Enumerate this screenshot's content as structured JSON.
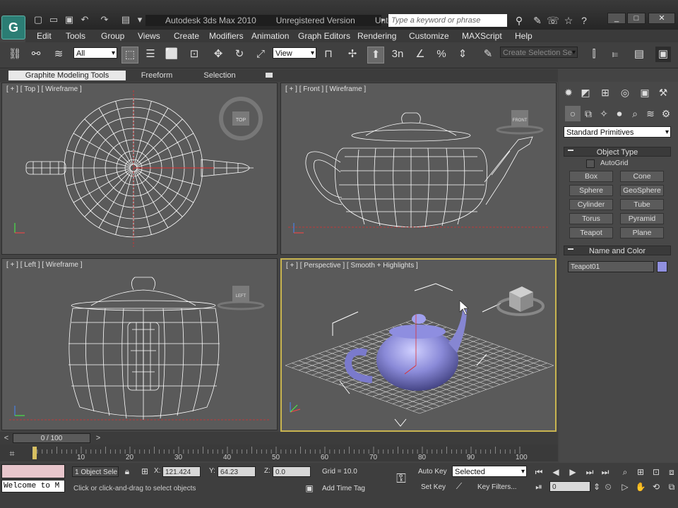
{
  "title_bar": {
    "app_title": "Autodesk 3ds Max  2010",
    "version": "Unregistered Version",
    "filename": "Untitled",
    "search_placeholder": "Type a keyword or phrase",
    "logo_text": "G"
  },
  "menu": [
    "Edit",
    "Tools",
    "Group",
    "Views",
    "Create",
    "Modifiers",
    "Animation",
    "Graph Editors",
    "Rendering",
    "Customize",
    "MAXScript",
    "Help"
  ],
  "toolbar": {
    "filter_value": "All",
    "refcoord_value": "View",
    "selection_set_placeholder": "Create Selection Se",
    "snap_3": "3",
    "snap_n": "n"
  },
  "ribbon": {
    "tabs": [
      "Graphite Modeling Tools",
      "Freeform",
      "Selection"
    ]
  },
  "viewports": {
    "top": {
      "label": "[ + ] [ Top ] [ Wireframe ]",
      "cube": "TOP"
    },
    "front": {
      "label": "[ + ] [ Front ] [ Wireframe ]",
      "cube": "FRONT"
    },
    "left": {
      "label": "[ + ] [ Left ] [ Wireframe ]",
      "cube": "LEFT"
    },
    "perspective": {
      "label": "[ + ] [ Perspective ] [ Smooth + Highlights ]"
    }
  },
  "command_panel": {
    "category_dropdown": "Standard Primitives",
    "object_type_header": "Object Type",
    "autogrid_label": "AutoGrid",
    "buttons": [
      "Box",
      "Cone",
      "Sphere",
      "GeoSphere",
      "Cylinder",
      "Tube",
      "Torus",
      "Pyramid",
      "Teapot",
      "Plane"
    ],
    "name_color_header": "Name and Color",
    "object_name": "Teapot01",
    "object_color": "#9090e0"
  },
  "timeline": {
    "frame_display": "0 / 100",
    "ticks": [
      "10",
      "20",
      "30",
      "40",
      "50",
      "60",
      "70",
      "80",
      "90",
      "100"
    ]
  },
  "status": {
    "listener_text": "Welcome to M",
    "selection_info": "1 Object Sele",
    "prompt": "Click or click-and-drag to select objects",
    "x_label": "X:",
    "x_value": "121.424",
    "y_label": "Y:",
    "y_value": "64.23",
    "z_label": "Z:",
    "z_value": "0.0",
    "grid": "Grid = 10.0",
    "add_time_tag": "Add Time Tag",
    "auto_key": "Auto Key",
    "set_key": "Set Key",
    "selected_value": "Selected",
    "key_filters": "Key Filters...",
    "frame_value": "0"
  },
  "colors": {
    "accent_viewport_border": "#c8b450",
    "axis_red": "#e03030",
    "wire": "#ffffff"
  }
}
